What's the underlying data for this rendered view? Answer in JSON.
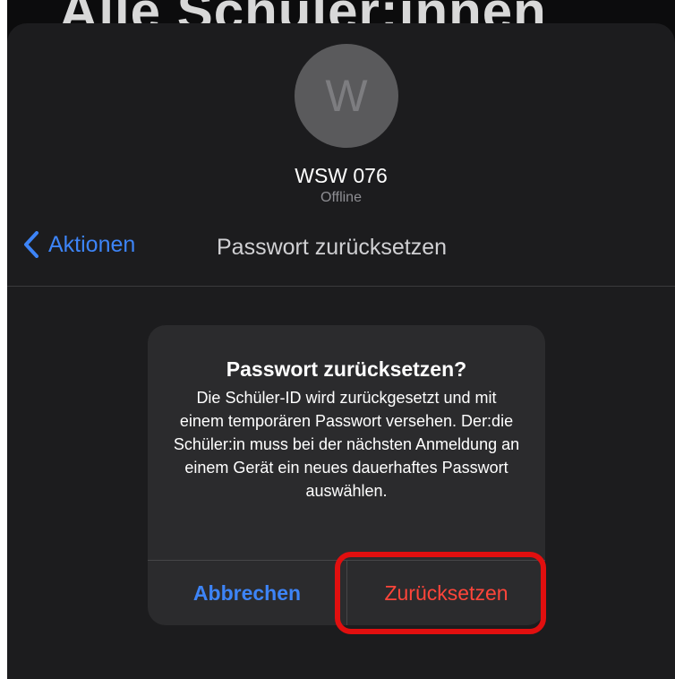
{
  "background": {
    "title": "Alle Schüler:innen"
  },
  "profile": {
    "avatar_initial": "W",
    "name": "WSW 076",
    "status": "Offline"
  },
  "nav": {
    "back_label": "Aktionen",
    "title": "Passwort zurücksetzen",
    "back_icon": "chevron-left-icon"
  },
  "alert": {
    "title": "Passwort zurücksetzen?",
    "message": "Die Schüler-ID wird zurückgesetzt und mit einem temporären Passwort versehen. Der:die Schüler:in muss bei der nächsten Anmeldung an einem Gerät ein neues dauerhaftes Passwort auswählen.",
    "cancel_label": "Abbrechen",
    "confirm_label": "Zurücksetzen"
  },
  "colors": {
    "accent_blue": "#3d84f7",
    "destructive_red": "#ff453a",
    "highlight_red": "#e10f0f",
    "sheet_bg": "#1c1c1e",
    "alert_bg": "#2b2b2d"
  }
}
